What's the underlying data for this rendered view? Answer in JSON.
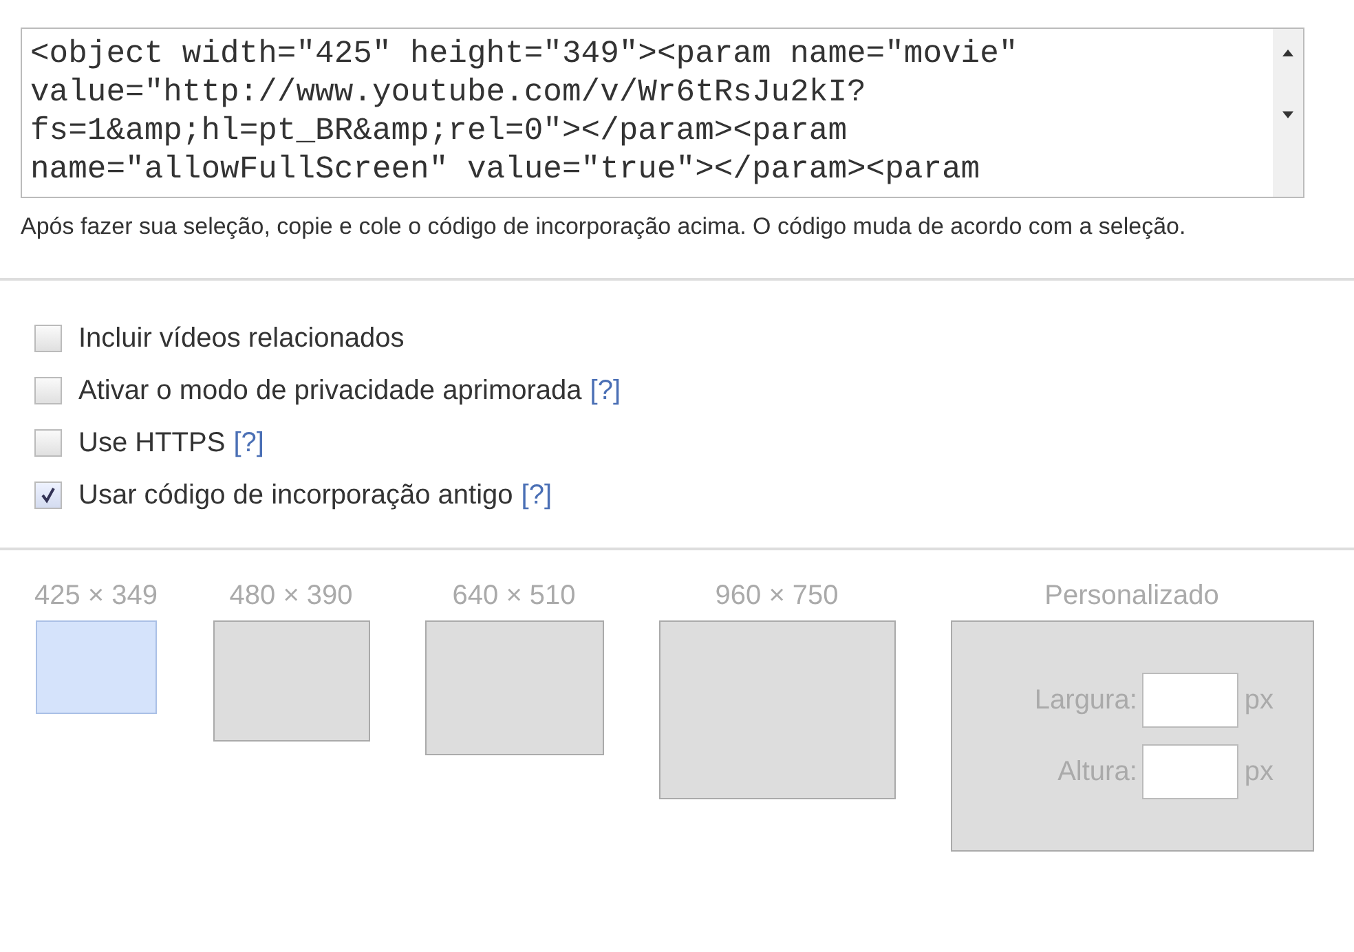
{
  "embed_code": {
    "value": "<object width=\"425\" height=\"349\"><param name=\"movie\"\nvalue=\"http://www.youtube.com/v/Wr6tRsJu2kI?\nfs=1&amp;hl=pt_BR&amp;rel=0\"></param><param\nname=\"allowFullScreen\" value=\"true\"></param><param"
  },
  "hint": "Após fazer sua seleção, copie e cole o código de incorporação acima. O código muda de acordo com a seleção.",
  "options": [
    {
      "label": "Incluir vídeos relacionados",
      "checked": false
    },
    {
      "label": "Ativar o modo de privacidade aprimorada",
      "checked": false,
      "help": "[?]"
    },
    {
      "label": "Use HTTPS",
      "checked": false,
      "help": "[?]"
    },
    {
      "label": "Usar código de incorporação antigo",
      "checked": true,
      "help": "[?]"
    }
  ],
  "sizes": [
    {
      "label": "425 × 349",
      "selected": true
    },
    {
      "label": "480 × 390",
      "selected": false
    },
    {
      "label": "640 × 510",
      "selected": false
    },
    {
      "label": "960 × 750",
      "selected": false
    }
  ],
  "custom": {
    "label": "Personalizado",
    "width_label": "Largura:",
    "width_unit": "px",
    "height_label": "Altura:",
    "height_unit": "px"
  }
}
